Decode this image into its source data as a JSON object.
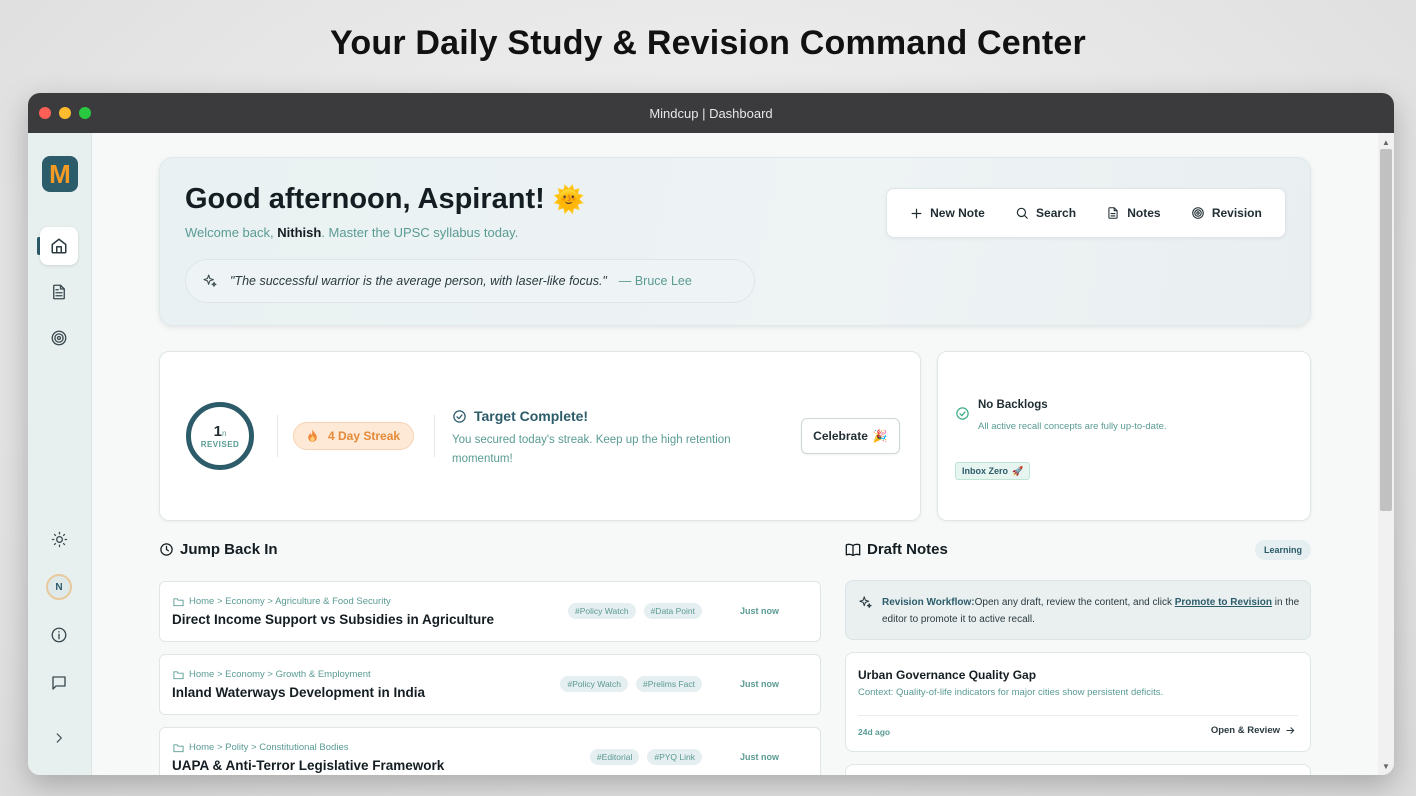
{
  "headline": "Your Daily Study & Revision Command Center",
  "window": {
    "title": "Mindcup | Dashboard"
  },
  "sidebar": {
    "logo": "M",
    "avatar_initial": "N",
    "icons": [
      "home-icon",
      "document-icon",
      "target-icon",
      "sun-icon",
      "info-icon",
      "chat-icon",
      "chevron-right-icon"
    ]
  },
  "hero": {
    "greeting": "Good afternoon, Aspirant!",
    "greeting_emoji": "🌞",
    "welcome_prefix": "Welcome back,",
    "user_name": "Nithish",
    "welcome_suffix": ". Master the UPSC syllabus today.",
    "quote": "\"The successful warrior is the average person, with laser-like focus.\"",
    "quote_author": "— Bruce Lee"
  },
  "actions": {
    "new_note": "New Note",
    "search": "Search",
    "notes": "Notes",
    "revision": "Revision"
  },
  "stats": {
    "revised_count": "1",
    "revised_unit": "n",
    "revised_label": "REVISED",
    "streak": "4 Day Streak",
    "target_title": "Target Complete!",
    "target_desc": "You secured today's streak. Keep up the high retention momentum!",
    "celebrate_label": "Celebrate",
    "celebrate_emoji": "🎉"
  },
  "backlog": {
    "title": "No Backlogs",
    "desc": "All active recall concepts are fully up-to-date.",
    "badge": "Inbox Zero",
    "badge_emoji": "🚀"
  },
  "jump_back": {
    "title": "Jump Back In",
    "items": [
      {
        "crumb": "Home > Economy > Agriculture & Food Security",
        "title": "Direct Income Support vs Subsidies in Agriculture",
        "tags": [
          "#Policy Watch",
          "#Data Point"
        ],
        "time": "Just now"
      },
      {
        "crumb": "Home > Economy > Growth & Employment",
        "title": "Inland Waterways Development in India",
        "tags": [
          "#Policy Watch",
          "#Prelims Fact"
        ],
        "time": "Just now"
      },
      {
        "crumb": "Home > Polity > Constitutional Bodies",
        "title": "UAPA & Anti-Terror Legislative Framework",
        "tags": [
          "#Editorial",
          "#PYQ Link"
        ],
        "time": "Just now"
      }
    ]
  },
  "draft_notes": {
    "title": "Draft Notes",
    "badge": "Learning",
    "workflow_label": "Revision Workflow:",
    "workflow_text": "Open any draft, review the content, and click",
    "workflow_link": "Promote to Revision",
    "workflow_suffix": "in the editor to promote it to active recall.",
    "draft": {
      "title": "Urban Governance Quality Gap",
      "context": "Context: Quality-of-life indicators for major cities show persistent deficits.",
      "age": "24d ago",
      "open_label": "Open & Review"
    }
  },
  "colors": {
    "accent": "#2c5b6a",
    "muted_teal": "#5a9b93",
    "streak": "#e48a3a"
  }
}
